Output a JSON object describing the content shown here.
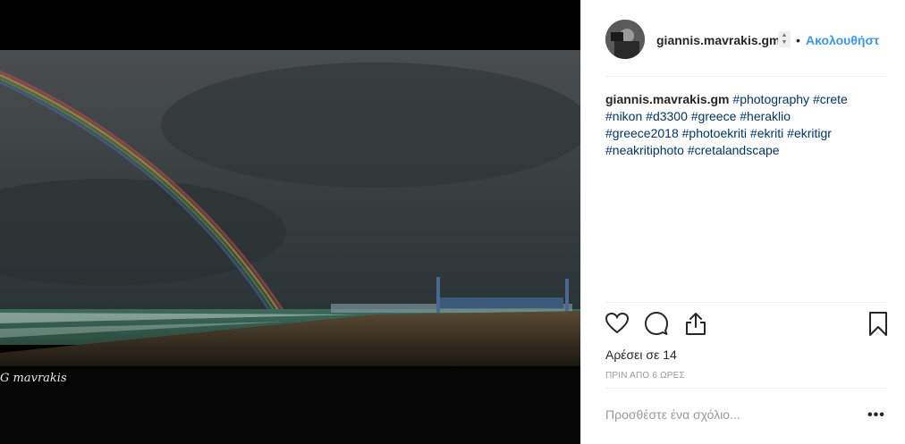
{
  "photo": {
    "watermark": "G mavrakis",
    "colors": {
      "sky": "#3d4244",
      "sea": "#2f5a4c",
      "sand": "#4a3f2e"
    }
  },
  "post": {
    "username": "giannis.mavrakis.gm",
    "follow_label": "Ακολουθήστ",
    "separator": "•",
    "caption": {
      "username": "giannis.mavrakis.gm",
      "hashtags": [
        "#photography",
        "#crete",
        "#nikon",
        "#d3300",
        "#greece",
        "#heraklio",
        "#greece2018",
        "#photoekriti",
        "#ekriti",
        "#ekritigr",
        "#neakritiphoto",
        "#cretalandscape"
      ]
    },
    "likes_label": "Αρέσει σε 14",
    "timestamp": "ΠΡΙΝ ΑΠΟ 6 ΩΡΕΣ",
    "comment_placeholder": "Προσθέστε ένα σχόλιο...",
    "more_label": "•••",
    "icons": [
      "heart-icon",
      "comment-icon",
      "share-icon",
      "bookmark-icon"
    ],
    "accent_color": "#3897f0"
  }
}
